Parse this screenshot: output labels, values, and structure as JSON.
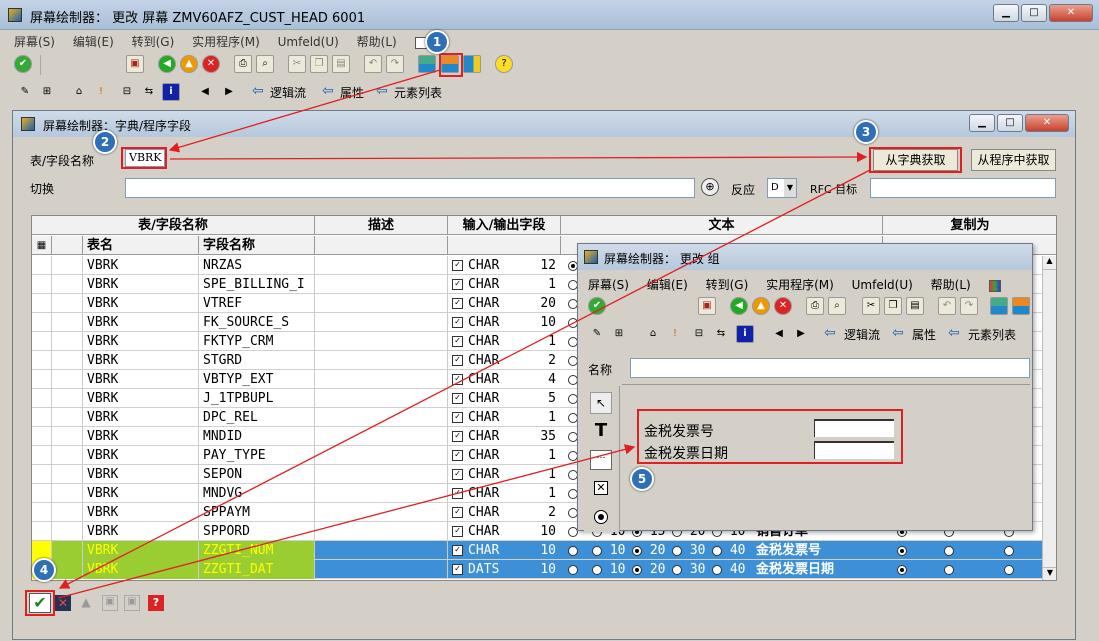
{
  "main_window": {
    "title": "屏幕绘制器： 更改 屏幕 ZMV60AFZ_CUST_HEAD 6001",
    "menu": [
      "屏幕(S)",
      "编辑(E)",
      "转到(G)",
      "实用程序(M)",
      "Umfeld(U)",
      "帮助(L)"
    ],
    "toolbar2": {
      "logic_flow": "逻辑流",
      "attributes": "属性",
      "element_list": "元素列表"
    }
  },
  "dict_dialog": {
    "title": "屏幕绘制器：字典/程序字段",
    "table_field_label": "表/字段名称",
    "table_field_value": "VBRK",
    "get_from_dict_button": "从字典获取",
    "get_from_program_button": "从程序中获取",
    "switch_label": "切换",
    "reverse_label": "反应",
    "reverse_value": "D",
    "rfc_target_label": "RFC 目标",
    "group_headers": {
      "table_field": "表/字段名称",
      "description": "描述",
      "io_field": "输入/输出字段",
      "text": "文本",
      "copy_as": "复制为"
    },
    "col_headers": {
      "table": "表名",
      "field": "字段名称"
    },
    "rows": [
      {
        "table": "VBRK",
        "field": "NRZAS",
        "type": "CHAR",
        "len": "12"
      },
      {
        "table": "VBRK",
        "field": "SPE_BILLING_I",
        "type": "CHAR",
        "len": "1"
      },
      {
        "table": "VBRK",
        "field": "VTREF",
        "type": "CHAR",
        "len": "20"
      },
      {
        "table": "VBRK",
        "field": "FK_SOURCE_S",
        "type": "CHAR",
        "len": "10"
      },
      {
        "table": "VBRK",
        "field": "FKTYP_CRM",
        "type": "CHAR",
        "len": "1"
      },
      {
        "table": "VBRK",
        "field": "STGRD",
        "type": "CHAR",
        "len": "2"
      },
      {
        "table": "VBRK",
        "field": "VBTYP_EXT",
        "type": "CHAR",
        "len": "4"
      },
      {
        "table": "VBRK",
        "field": "J_1TPBUPL",
        "type": "CHAR",
        "len": "5"
      },
      {
        "table": "VBRK",
        "field": "DPC_REL",
        "type": "CHAR",
        "len": "1"
      },
      {
        "table": "VBRK",
        "field": "MNDID",
        "type": "CHAR",
        "len": "35"
      },
      {
        "table": "VBRK",
        "field": "PAY_TYPE",
        "type": "CHAR",
        "len": "1"
      },
      {
        "table": "VBRK",
        "field": "SEPON",
        "type": "CHAR",
        "len": "1"
      },
      {
        "table": "VBRK",
        "field": "MNDVG",
        "type": "CHAR",
        "len": "1"
      },
      {
        "table": "VBRK",
        "field": "SPPAYM",
        "type": "CHAR",
        "len": "2"
      },
      {
        "table": "VBRK",
        "field": "SPPORD",
        "type": "CHAR",
        "len": "10",
        "textopts": [
          "10",
          "15",
          "20",
          "10"
        ],
        "text": "销售订单"
      },
      {
        "table": "VBRK",
        "field": "ZZGTI_NUM",
        "type": "CHAR",
        "len": "10",
        "textopts": [
          "10",
          "20",
          "30",
          "40"
        ],
        "text": "金税发票号",
        "selected": true
      },
      {
        "table": "VBRK",
        "field": "ZZGTI_DAT",
        "type": "DATS",
        "len": "10",
        "textopts": [
          "10",
          "20",
          "30",
          "40"
        ],
        "text": "金税发票日期",
        "selected": true
      }
    ]
  },
  "change_window": {
    "title": "屏幕绘制器： 更改 组",
    "menu": [
      "屏幕(S)",
      "编辑(E)",
      "转到(G)",
      "实用程序(M)",
      "Umfeld(U)",
      "帮助(L)"
    ],
    "toolbar2": {
      "logic_flow": "逻辑流",
      "attributes": "属性",
      "element_list": "元素列表"
    },
    "name_label": "名称",
    "fields": [
      {
        "label": "金税发票号"
      },
      {
        "label": "金税发票日期"
      }
    ]
  },
  "badges": [
    "1",
    "2",
    "3",
    "4",
    "5"
  ],
  "colors": {
    "highlight": "#e02020",
    "badge": "#2e6fb5",
    "selected_row": "#3d8fd6",
    "yellow_text": "#ffff00"
  }
}
